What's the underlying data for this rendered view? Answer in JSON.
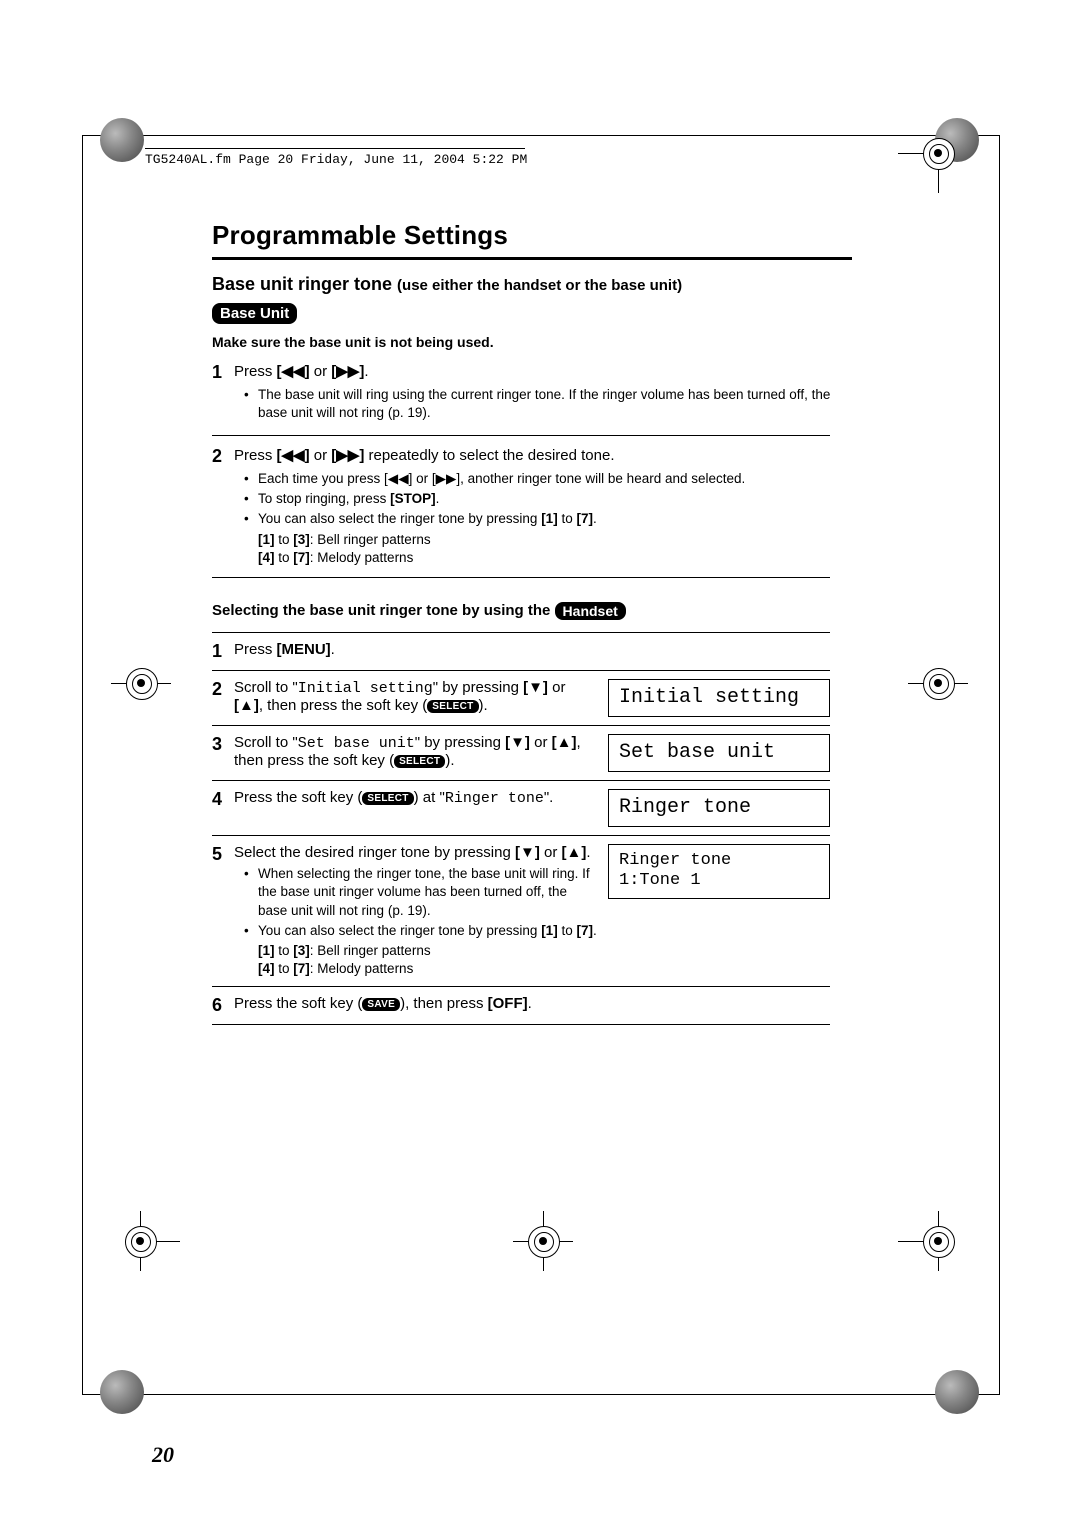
{
  "header_line": "TG5240AL.fm  Page 20  Friday, June 11, 2004  5:22 PM",
  "title": "Programmable Settings",
  "sub1_main": "Base unit ringer tone ",
  "sub1_paren": "(use either the handset or the base unit)",
  "pill_base": "Base Unit",
  "warn": "Make sure the base unit is not being used.",
  "base_steps": {
    "s1_num": "1",
    "s1_text_a": "Press ",
    "s1_text_b": " or ",
    "s1_text_c": ".",
    "s1_bullet": "The base unit will ring using the current ringer tone. If the ringer volume has been turned off, the base unit will not ring (p. 19).",
    "s2_num": "2",
    "s2_text_a": "Press ",
    "s2_text_b": " or ",
    "s2_text_c": " repeatedly to select the desired tone.",
    "s2_bullets": [
      "Each time you press [◀◀] or [▶▶], another ringer tone will be heard and selected.",
      "To stop ringing, press [STOP].",
      "You can also select the ringer tone by pressing [1] to [7]."
    ],
    "s2_post1": "[1] to [3]: Bell ringer patterns",
    "s2_post2": "[4] to [7]: Melody patterns"
  },
  "sub2_a": "Selecting the base unit ringer tone by using the ",
  "sub2_pill": "Handset",
  "hs": {
    "s1_num": "1",
    "s1": "Press [MENU].",
    "s2_num": "2",
    "s2_a": "Scroll to \"",
    "s2_mono": "Initial setting",
    "s2_b": "\" by pressing [▼] or [▲], then press the soft key (",
    "s2_c": ").",
    "d2": "Initial setting",
    "s3_num": "3",
    "s3_a": "Scroll to \"",
    "s3_mono": "Set base unit",
    "s3_b": "\" by pressing [▼] or [▲], then press the soft key (",
    "s3_c": ").",
    "d3": "Set base unit",
    "s4_num": "4",
    "s4_a": "Press the soft key (",
    "s4_b": ") at \"",
    "s4_mono": "Ringer tone",
    "s4_c": "\".",
    "d4": "Ringer tone",
    "s5_num": "5",
    "s5_a": "Select the desired ringer tone by pressing [▼] or [▲].",
    "s5_bullets": [
      "When selecting the ringer tone, the base unit will ring. If the base unit ringer volume has been turned off, the base unit will not ring (p. 19).",
      "You can also select the ringer tone by pressing [1] to [7]."
    ],
    "s5_post1": "[1] to [3]: Bell ringer patterns",
    "s5_post2": "[4] to [7]: Melody patterns",
    "d5a": "Ringer tone",
    "d5b": "1:Tone 1",
    "s6_num": "6",
    "s6_a": "Press the soft key (",
    "s6_b": "), then press [OFF]."
  },
  "select_badge": "SELECT",
  "save_badge": "SAVE",
  "rew": "[◀◀]",
  "ffwd": "[▶▶]",
  "page_num": "20"
}
